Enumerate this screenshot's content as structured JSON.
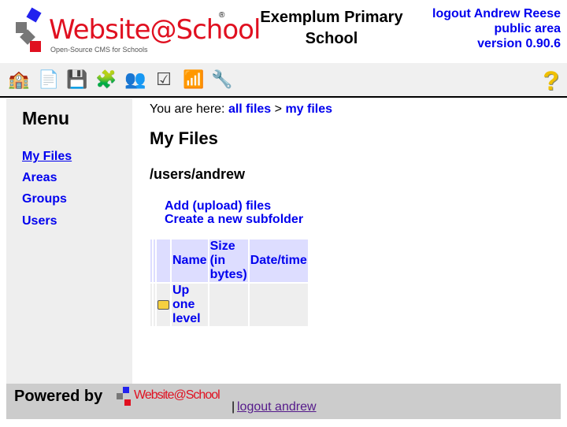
{
  "header": {
    "logo_text": "Website@School",
    "logo_tagline": "Open-Source CMS for Schools",
    "site_title": "Exemplum Primary School",
    "logout_label": "logout Andrew Reese",
    "public_area_label": "public area",
    "version_label": "version 0.90.6"
  },
  "toolbar": {
    "icons": [
      "start-center-icon",
      "page-manager-icon",
      "file-manager-icon",
      "modules-icon",
      "account-manager-icon",
      "configuration-icon",
      "statistics-icon",
      "tools-icon"
    ],
    "help_label": "?"
  },
  "menu": {
    "title": "Menu",
    "items": [
      {
        "label": "My Files",
        "active": true
      },
      {
        "label": "Areas"
      },
      {
        "label": "Groups"
      },
      {
        "label": "Users"
      }
    ]
  },
  "breadcrumb": {
    "prefix": "You are here:",
    "items": [
      "all files",
      "my files"
    ],
    "separator": ">"
  },
  "main": {
    "title": "My Files",
    "path": "/users/andrew",
    "actions": [
      "Add (upload) files",
      "Create a new subfolder"
    ],
    "table": {
      "headers": [
        "",
        "",
        "",
        "Name",
        "Size (in bytes)",
        "Date/time"
      ],
      "rows": [
        {
          "name": "Up one level",
          "size": "",
          "date": ""
        }
      ]
    }
  },
  "footer": {
    "powered_by": "Powered by",
    "logo_text": "Website@School",
    "separator": "|",
    "logout_label": "logout andrew"
  }
}
